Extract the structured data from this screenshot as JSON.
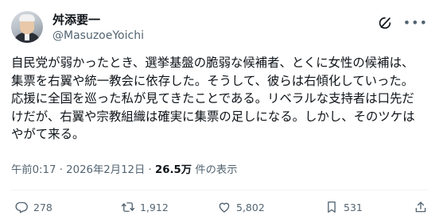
{
  "author": {
    "display_name": "舛添要一",
    "handle": "@MasuzoeYoichi"
  },
  "tweet": {
    "text": "自民党が弱かったとき、選挙基盤の脆弱な候補者、とくに女性の候補は、\n集票を右翼や統一教会に依存した。そうして、彼らは右傾化していった。\n応援に全国を巡った私が見てきたことである。リベラルな支持者は口先だ\nけだが、右翼や宗教組織は確実に集票の足しになる。しかし、そのツケは\nやがて来る。",
    "time": "午前0:17",
    "separator": "·",
    "date": "2026年2月12日",
    "views_count": "26.5万",
    "views_label": "件の表示"
  },
  "actions": {
    "replies": "278",
    "reposts": "1,912",
    "likes": "5,802",
    "bookmarks": "531"
  },
  "icons": {
    "grok": "grok-icon",
    "more": "more-icon",
    "reply": "reply-icon",
    "repost": "repost-icon",
    "like": "like-icon",
    "bookmark": "bookmark-icon",
    "share": "share-icon"
  },
  "colors": {
    "text": "#0f1419",
    "secondary": "#536471",
    "divider": "#eff3f4"
  }
}
